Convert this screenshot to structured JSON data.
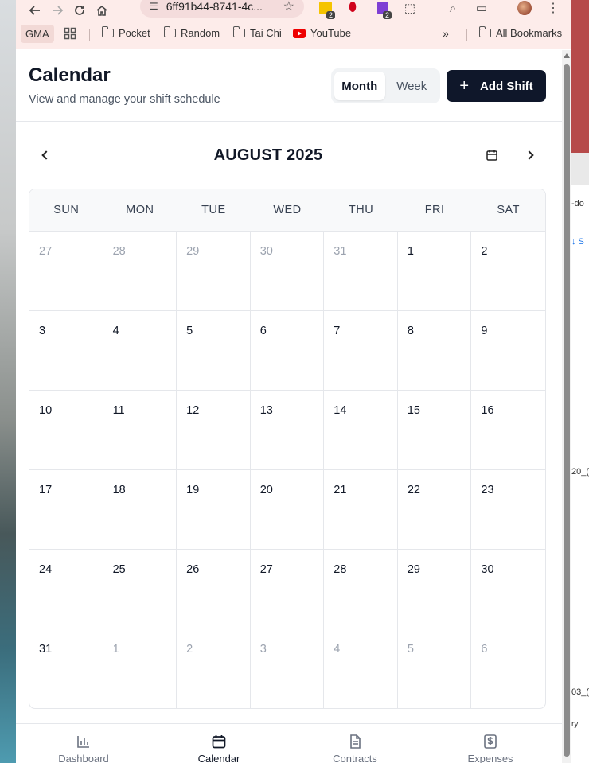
{
  "browser": {
    "url": "6ff91b44-8741-4c...",
    "extensions": {
      "yellow_badge": "2",
      "purple_badge": "2"
    },
    "bookmarks": [
      "GMA",
      "Pocket",
      "Random",
      "Tai Chi",
      "YouTube"
    ],
    "all_bookmarks": "All Bookmarks"
  },
  "header": {
    "title": "Calendar",
    "subtitle": "View and manage your shift schedule",
    "view_toggle": {
      "month": "Month",
      "week": "Week",
      "selected": "Month"
    },
    "add_button": "Add Shift"
  },
  "calendar": {
    "month_label": "AUGUST 2025",
    "weekdays": [
      "SUN",
      "MON",
      "TUE",
      "WED",
      "THU",
      "FRI",
      "SAT"
    ],
    "days": [
      {
        "n": "27",
        "muted": true
      },
      {
        "n": "28",
        "muted": true
      },
      {
        "n": "29",
        "muted": true
      },
      {
        "n": "30",
        "muted": true
      },
      {
        "n": "31",
        "muted": true
      },
      {
        "n": "1",
        "muted": false
      },
      {
        "n": "2",
        "muted": false
      },
      {
        "n": "3",
        "muted": false
      },
      {
        "n": "4",
        "muted": false
      },
      {
        "n": "5",
        "muted": false
      },
      {
        "n": "6",
        "muted": false
      },
      {
        "n": "7",
        "muted": false
      },
      {
        "n": "8",
        "muted": false
      },
      {
        "n": "9",
        "muted": false
      },
      {
        "n": "10",
        "muted": false
      },
      {
        "n": "11",
        "muted": false
      },
      {
        "n": "12",
        "muted": false
      },
      {
        "n": "13",
        "muted": false
      },
      {
        "n": "14",
        "muted": false
      },
      {
        "n": "15",
        "muted": false
      },
      {
        "n": "16",
        "muted": false
      },
      {
        "n": "17",
        "muted": false
      },
      {
        "n": "18",
        "muted": false
      },
      {
        "n": "19",
        "muted": false
      },
      {
        "n": "20",
        "muted": false
      },
      {
        "n": "21",
        "muted": false
      },
      {
        "n": "22",
        "muted": false
      },
      {
        "n": "23",
        "muted": false
      },
      {
        "n": "24",
        "muted": false
      },
      {
        "n": "25",
        "muted": false
      },
      {
        "n": "26",
        "muted": false
      },
      {
        "n": "27",
        "muted": false
      },
      {
        "n": "28",
        "muted": false
      },
      {
        "n": "29",
        "muted": false
      },
      {
        "n": "30",
        "muted": false
      },
      {
        "n": "31",
        "muted": false
      },
      {
        "n": "1",
        "muted": true
      },
      {
        "n": "2",
        "muted": true
      },
      {
        "n": "3",
        "muted": true
      },
      {
        "n": "4",
        "muted": true
      },
      {
        "n": "5",
        "muted": true
      },
      {
        "n": "6",
        "muted": true
      }
    ]
  },
  "bottom_nav": {
    "items": [
      {
        "label": "Dashboard",
        "icon": "chart-icon",
        "active": false
      },
      {
        "label": "Calendar",
        "icon": "calendar-icon",
        "active": true
      },
      {
        "label": "Contracts",
        "icon": "document-icon",
        "active": false
      },
      {
        "label": "Expenses",
        "icon": "dollar-icon",
        "active": false
      }
    ]
  },
  "background_window": {
    "fragments": [
      "-do",
      "↓ S",
      "20_(",
      "03_(",
      "ry"
    ]
  },
  "colors": {
    "accent_dark": "#0f172a",
    "browser_chrome": "#fdecea",
    "muted_text": "#9ca3af"
  }
}
